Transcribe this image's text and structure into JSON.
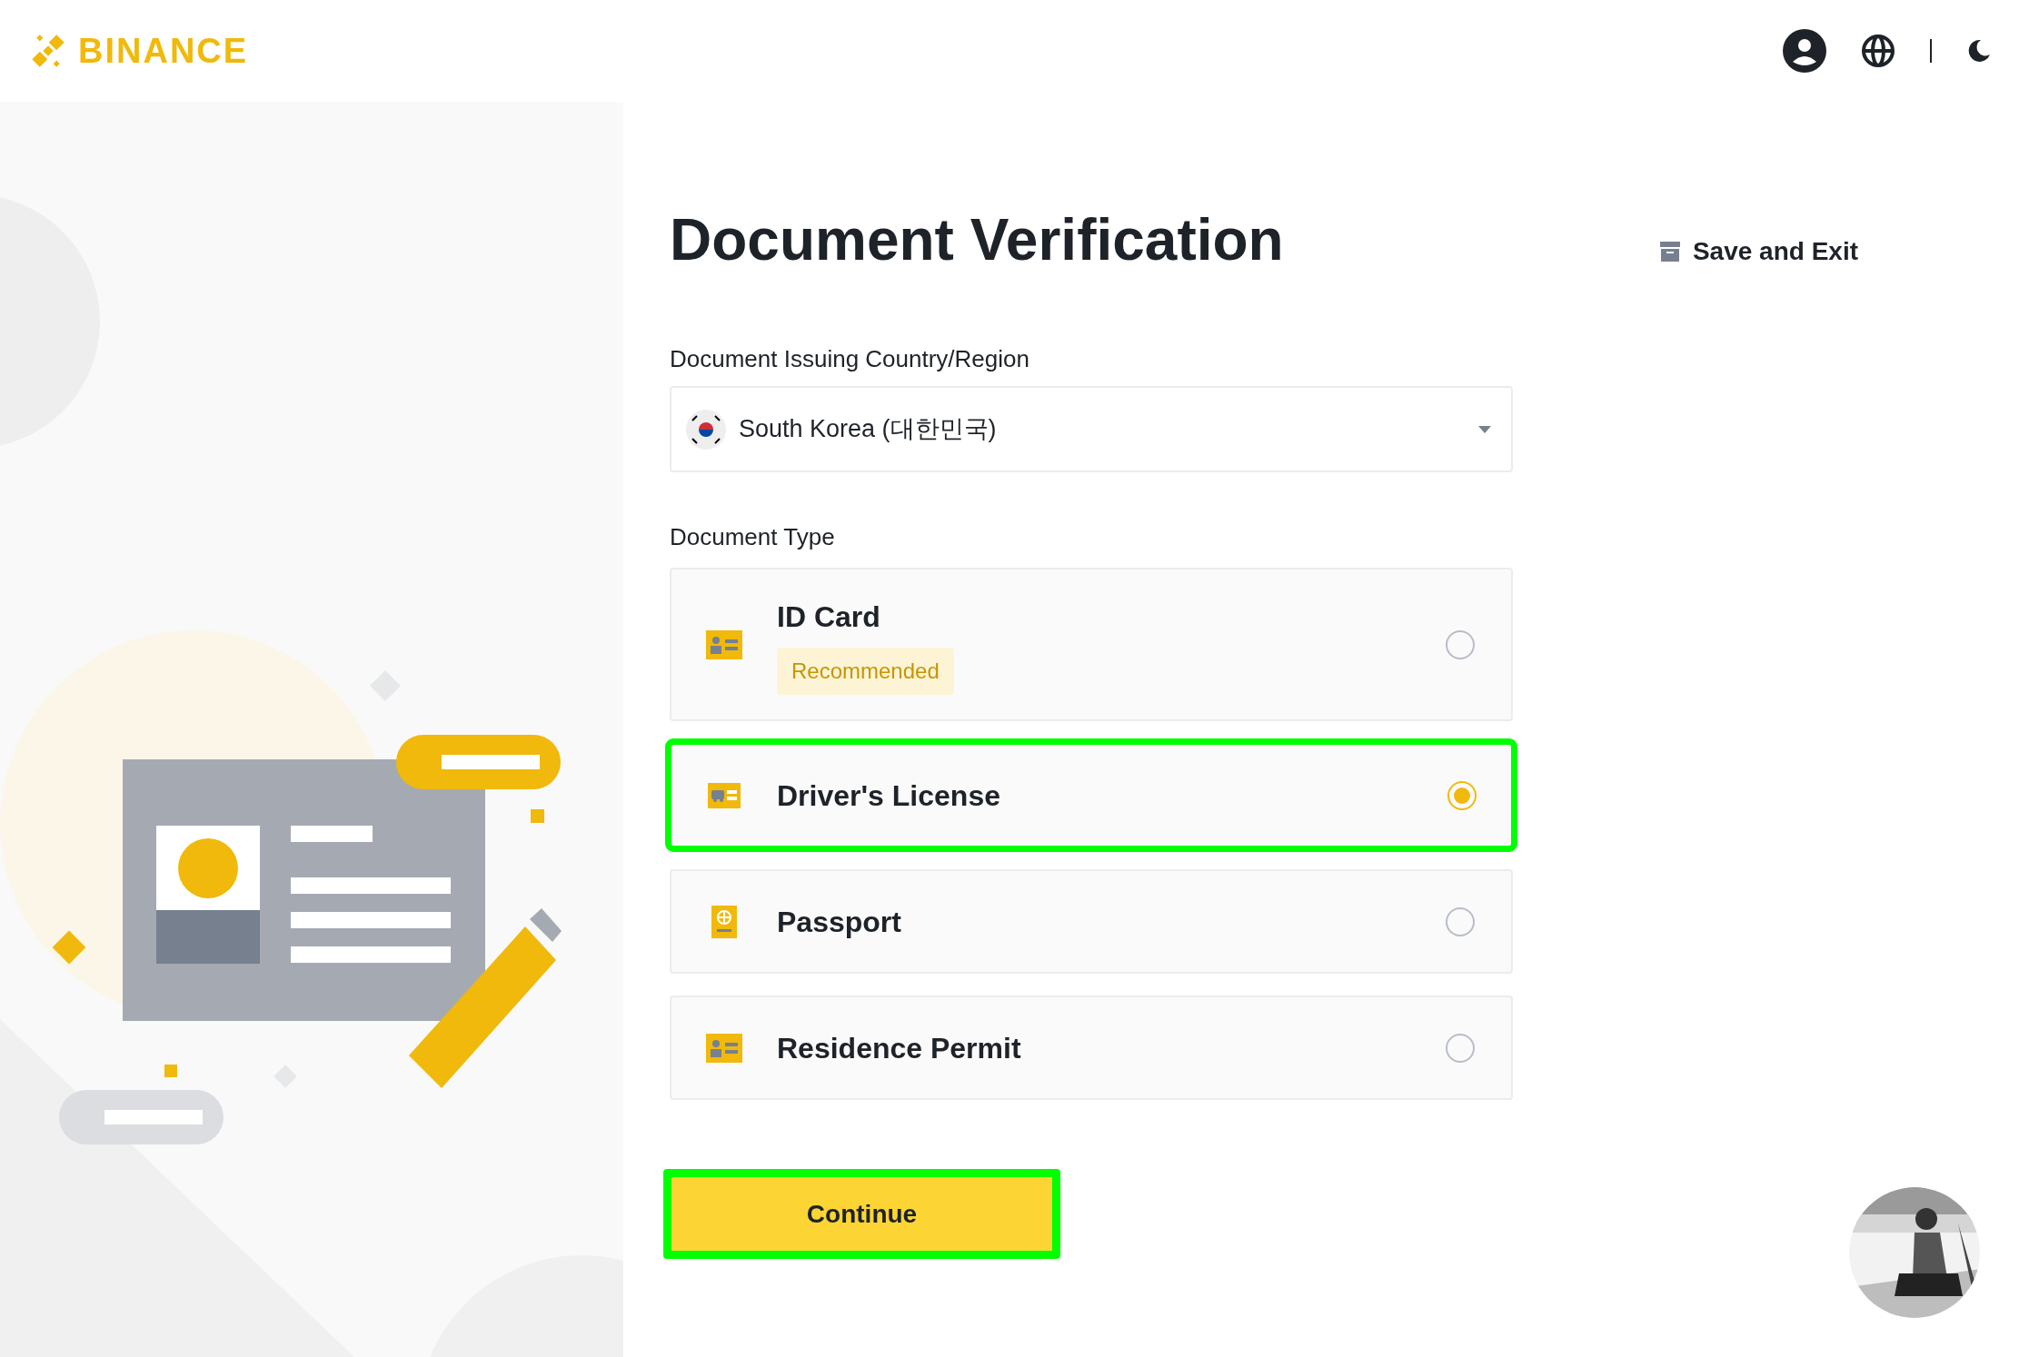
{
  "header": {
    "logo": "BINANCE"
  },
  "page": {
    "title": "Document Verification",
    "save_exit": "Save and Exit"
  },
  "country": {
    "label": "Document Issuing Country/Region",
    "value": "South Korea (대한민국)"
  },
  "document_type": {
    "label": "Document Type",
    "options": [
      {
        "kind": "id",
        "label": "ID Card",
        "badge": "Recommended",
        "selected": false,
        "highlighted": false
      },
      {
        "kind": "car",
        "label": "Driver's License",
        "selected": true,
        "highlighted": true
      },
      {
        "kind": "passport",
        "label": "Passport",
        "selected": false,
        "highlighted": false
      },
      {
        "kind": "id",
        "label": "Residence Permit",
        "selected": false,
        "highlighted": false
      }
    ]
  },
  "continue_button": {
    "label": "Continue",
    "highlighted": true
  }
}
